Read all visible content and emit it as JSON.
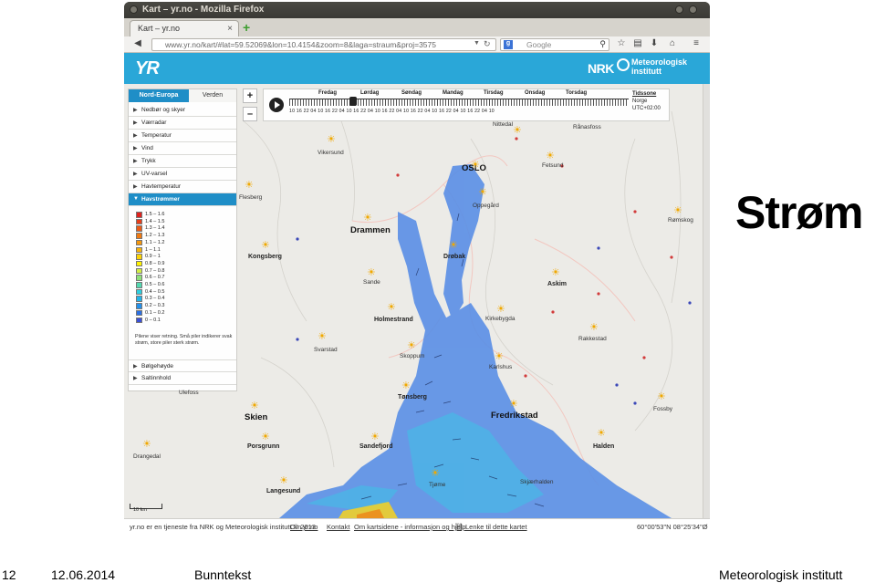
{
  "window": {
    "title": "Kart – yr.no - Mozilla Firefox"
  },
  "tab": {
    "label": "Kart – yr.no"
  },
  "navbar": {
    "url": "www.yr.no/kart/#lat=59.52069&lon=10.4154&zoom=8&laga=straum&proj=3575",
    "search_placeholder": "Google"
  },
  "header": {
    "logo": "YR",
    "nrk": "NRK",
    "met_line1": "Meteorologisk",
    "met_line2": "institutt"
  },
  "panel": {
    "tabs": [
      "Nord-Europa",
      "Verden"
    ],
    "items": [
      "Nedbør og skyer",
      "Værradar",
      "Temperatur",
      "Vind",
      "Trykk",
      "UV-varsel",
      "Havtemperatur",
      "Havstrømmer"
    ],
    "legend": [
      {
        "label": "1.5 – 1.6",
        "color": "#e0231e"
      },
      {
        "label": "1.4 – 1.5",
        "color": "#e63e1a"
      },
      {
        "label": "1.3 – 1.4",
        "color": "#ec5a16"
      },
      {
        "label": "1.2 – 1.3",
        "color": "#f07a12"
      },
      {
        "label": "1.1 – 1.2",
        "color": "#f4960e"
      },
      {
        "label": "1 – 1.1",
        "color": "#f8b40a"
      },
      {
        "label": "0.9 – 1",
        "color": "#fbd306"
      },
      {
        "label": "0.8 – 0.9",
        "color": "#fff200"
      },
      {
        "label": "0.7 – 0.8",
        "color": "#d2ee46"
      },
      {
        "label": "0.6 – 0.7",
        "color": "#8fe07a"
      },
      {
        "label": "0.5 – 0.6",
        "color": "#53d8b0"
      },
      {
        "label": "0.4 – 0.5",
        "color": "#2ed0e0"
      },
      {
        "label": "0.3 – 0.4",
        "color": "#22b4ea"
      },
      {
        "label": "0.2 – 0.3",
        "color": "#2490ea"
      },
      {
        "label": "0.1 – 0.2",
        "color": "#2a70e4"
      },
      {
        "label": "0 – 0.1",
        "color": "#3a50d8"
      }
    ],
    "note": "Pilene viser retning. Små piler indikerer svak strøm, store piler sterk strøm.",
    "bottom_items": [
      "Bølgehøyde",
      "Saltinnhold"
    ]
  },
  "zoom": {
    "in": "+",
    "out": "–"
  },
  "timeline": {
    "days": [
      "Fredag",
      "Lørdag",
      "Søndag",
      "Mandag",
      "Tirsdag",
      "Onsdag",
      "Torsdag"
    ],
    "hours": "10  16  22  04  10  16  22  04  10  16  22  04  10  16  22  04  10  16  22  04  10  16  22  04  10  16  22  04  10",
    "tz_title": "Tidssone",
    "tz_region": "Norge",
    "tz_offset": "UTC+02:00"
  },
  "places": {
    "oslo": "OSLO",
    "drammen": "Drammen",
    "skien": "Skien",
    "fredrikstad": "Fredrikstad",
    "kongsberg": "Kongsberg",
    "drobak": "Drøbak",
    "askim": "Askim",
    "holmestrand": "Holmestrand",
    "tonsberg": "Tønsberg",
    "porsgrunn": "Porsgrunn",
    "sandefjord": "Sandefjord",
    "larvik": "Langesund",
    "halden": "Halden",
    "rakkestad": "Rakkestad",
    "vikersund": "Vikersund",
    "flesberg": "Flesberg",
    "fetsund": "Fetsund",
    "oppegard": "Oppegård",
    "ronasfoss": "Rånasfoss",
    "nittedal": "Nittedal",
    "romskog": "Rømskog",
    "sande": "Sande",
    "kirkebygda": "Kirkebygda",
    "svarstad": "Svarstad",
    "skoppum": "Skoppum",
    "karlshus": "Karlshus",
    "fossby": "Fossby",
    "ulefoss": "Ulefoss",
    "drangedal": "Drangedal",
    "skjaerhalden": "Skjærhalden",
    "tjome": "Tjøme"
  },
  "scale": "10 km",
  "footer": {
    "credit": "yr.no er en tjeneste fra NRK og Meteorologisk institutt © 2013",
    "links": [
      "Om yr.no",
      "Kontakt",
      "Om kartsidene - informasjon og hjelp",
      "Lenke til dette kartet"
    ],
    "coords": "60°00'53\"N 08°25'34\"Ø"
  },
  "slide": {
    "title": "Strøm",
    "page": "12",
    "date": "12.06.2014",
    "footer_text": "Bunntekst",
    "org": "Meteorologisk institutt"
  }
}
